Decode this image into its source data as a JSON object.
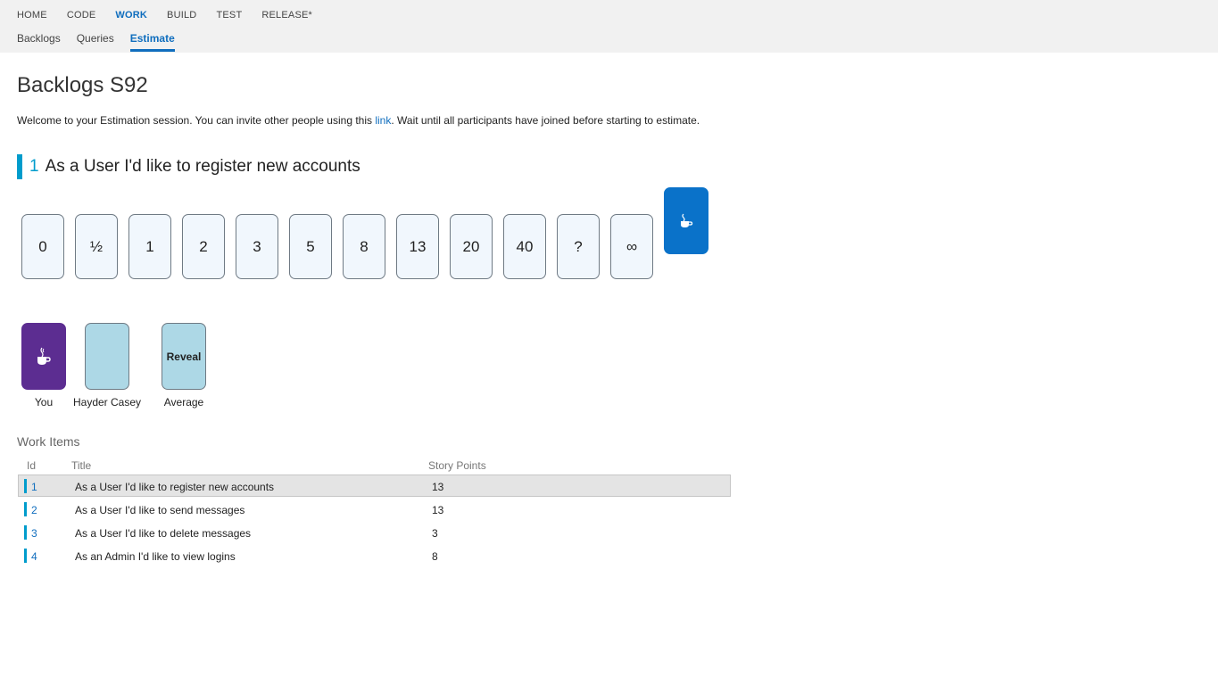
{
  "nav": {
    "top": [
      "HOME",
      "CODE",
      "WORK",
      "BUILD",
      "TEST",
      "RELEASE*"
    ],
    "active_top": "WORK",
    "sub": [
      "Backlogs",
      "Queries",
      "Estimate"
    ],
    "active_sub": "Estimate"
  },
  "page": {
    "title": "Backlogs S92",
    "welcome_before": "Welcome to your Estimation session. You can invite other people using this ",
    "welcome_link": "link",
    "welcome_after": ". Wait until all participants have joined before starting to estimate."
  },
  "current_item": {
    "id": "1",
    "title": "As a User I'd like to register new accounts",
    "accent_color": "#009ccc"
  },
  "cards": [
    "0",
    "½",
    "1",
    "2",
    "3",
    "5",
    "8",
    "13",
    "20",
    "40",
    "?",
    "∞"
  ],
  "coffee_card": {
    "icon": "coffee-icon",
    "color": "#0a72c9"
  },
  "participants": [
    {
      "label": "You",
      "card": "coffee-icon",
      "color": "#5c2d91"
    },
    {
      "label": "Hayder Casey",
      "card": "",
      "color": "#add8e6"
    },
    {
      "label": "Average",
      "card": "Reveal",
      "color": "#add8e6"
    }
  ],
  "work_items": {
    "heading": "Work Items",
    "columns": [
      "Id",
      "Title",
      "Story Points"
    ],
    "rows": [
      {
        "id": "1",
        "title": "As a User I'd like to register new accounts",
        "points": "13",
        "selected": true
      },
      {
        "id": "2",
        "title": "As a User I'd like to send messages",
        "points": "13",
        "selected": false
      },
      {
        "id": "3",
        "title": "As a User I'd like to delete messages",
        "points": "3",
        "selected": false
      },
      {
        "id": "4",
        "title": "As an Admin I'd like to view logins",
        "points": "8",
        "selected": false
      }
    ]
  }
}
